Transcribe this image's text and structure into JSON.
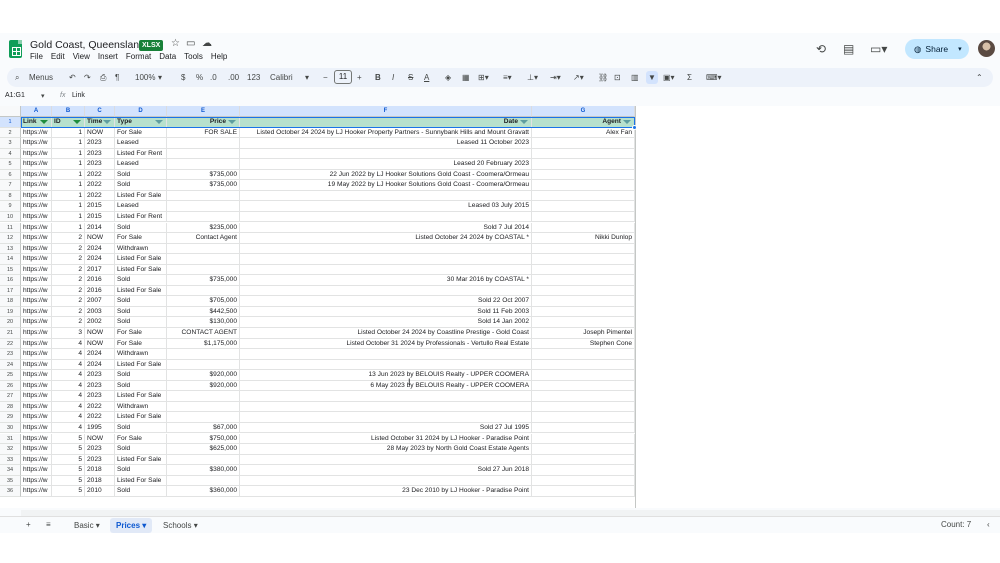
{
  "window": {
    "doc_title": "Gold Coast, Queensland",
    "file_badge": "XLSX",
    "menus": [
      "File",
      "Edit",
      "View",
      "Insert",
      "Format",
      "Data",
      "Tools",
      "Help"
    ],
    "share_label": "Share"
  },
  "toolbar": {
    "menus_label": "Menus",
    "zoom": "100%",
    "currency": "$",
    "percent": "%",
    "decimal_decrease": ".0",
    "decimal_increase": ".00",
    "number_format": "123",
    "font": "Calibri",
    "font_size": "11",
    "bold": "B",
    "italic": "I",
    "strike": "S",
    "text_color": "A",
    "functions": "Σ"
  },
  "formula_bar": {
    "name_box": "A1:G1",
    "fx": "fx",
    "content": "Link"
  },
  "grid": {
    "column_letters": [
      "A",
      "B",
      "C",
      "D",
      "E",
      "F",
      "G"
    ],
    "headers": [
      "Link",
      "ID",
      "Time",
      "Type",
      "Price",
      "Date",
      "Agent"
    ],
    "rows": [
      [
        "https://w",
        "1",
        "NOW",
        "For Sale",
        "FOR SALE",
        "Listed October 24 2024 by LJ Hooker Property Partners - Sunnybank Hills and Mount Gravatt",
        "Alex Fan"
      ],
      [
        "https://w",
        "1",
        "2023",
        "Leased",
        "",
        "Leased 11 October 2023",
        ""
      ],
      [
        "https://w",
        "1",
        "2023",
        "Listed For Rent",
        "",
        "",
        ""
      ],
      [
        "https://w",
        "1",
        "2023",
        "Leased",
        "",
        "Leased 20 February 2023",
        ""
      ],
      [
        "https://w",
        "1",
        "2022",
        "Sold",
        "$735,000",
        "22 Jun 2022 by LJ Hooker Solutions Gold Coast - Coomera/Ormeau",
        ""
      ],
      [
        "https://w",
        "1",
        "2022",
        "Sold",
        "$735,000",
        "19 May 2022 by LJ Hooker Solutions Gold Coast - Coomera/Ormeau",
        ""
      ],
      [
        "https://w",
        "1",
        "2022",
        "Listed For Sale",
        "",
        "",
        ""
      ],
      [
        "https://w",
        "1",
        "2015",
        "Leased",
        "",
        "Leased 03 July 2015",
        ""
      ],
      [
        "https://w",
        "1",
        "2015",
        "Listed For Rent",
        "",
        "",
        ""
      ],
      [
        "https://w",
        "1",
        "2014",
        "Sold",
        "$235,000",
        "Sold 7 Jul 2014",
        ""
      ],
      [
        "https://w",
        "2",
        "NOW",
        "For Sale",
        "Contact Agent",
        "Listed October 24 2024 by COASTAL *",
        "Nikki Dunlop"
      ],
      [
        "https://w",
        "2",
        "2024",
        "Withdrawn",
        "",
        "",
        ""
      ],
      [
        "https://w",
        "2",
        "2024",
        "Listed For Sale",
        "",
        "",
        ""
      ],
      [
        "https://w",
        "2",
        "2017",
        "Listed For Sale",
        "",
        "",
        ""
      ],
      [
        "https://w",
        "2",
        "2016",
        "Sold",
        "$735,000",
        "30 Mar 2016 by COASTAL *",
        ""
      ],
      [
        "https://w",
        "2",
        "2016",
        "Listed For Sale",
        "",
        "",
        ""
      ],
      [
        "https://w",
        "2",
        "2007",
        "Sold",
        "$705,000",
        "Sold 22 Oct 2007",
        ""
      ],
      [
        "https://w",
        "2",
        "2003",
        "Sold",
        "$442,500",
        "Sold 11 Feb 2003",
        ""
      ],
      [
        "https://w",
        "2",
        "2002",
        "Sold",
        "$130,000",
        "Sold 14 Jan 2002",
        ""
      ],
      [
        "https://w",
        "3",
        "NOW",
        "For Sale",
        "CONTACT AGENT",
        "Listed October 24 2024 by Coastline Prestige - Gold Coast",
        "Joseph Pimentel"
      ],
      [
        "https://w",
        "4",
        "NOW",
        "For Sale",
        "$1,175,000",
        "Listed October 31 2024 by Professionals - Vertullo Real Estate",
        "Stephen Cone"
      ],
      [
        "https://w",
        "4",
        "2024",
        "Withdrawn",
        "",
        "",
        ""
      ],
      [
        "https://w",
        "4",
        "2024",
        "Listed For Sale",
        "",
        "",
        ""
      ],
      [
        "https://w",
        "4",
        "2023",
        "Sold",
        "$920,000",
        "13 Jun 2023 by BELOUIS Realty - UPPER COOMERA",
        ""
      ],
      [
        "https://w",
        "4",
        "2023",
        "Sold",
        "$920,000",
        "6 May 2023 by BELOUIS Realty - UPPER COOMERA",
        ""
      ],
      [
        "https://w",
        "4",
        "2023",
        "Listed For Sale",
        "",
        "",
        ""
      ],
      [
        "https://w",
        "4",
        "2022",
        "Withdrawn",
        "",
        "",
        ""
      ],
      [
        "https://w",
        "4",
        "2022",
        "Listed For Sale",
        "",
        "",
        ""
      ],
      [
        "https://w",
        "4",
        "1995",
        "Sold",
        "$67,000",
        "Sold 27 Jul 1995",
        ""
      ],
      [
        "https://w",
        "5",
        "NOW",
        "For Sale",
        "$750,000",
        "Listed October 31 2024 by LJ Hooker - Paradise Point",
        ""
      ],
      [
        "https://w",
        "5",
        "2023",
        "Sold",
        "$625,000",
        "28 May 2023 by North Gold Coast Estate Agents",
        ""
      ],
      [
        "https://w",
        "5",
        "2023",
        "Listed For Sale",
        "",
        "",
        ""
      ],
      [
        "https://w",
        "5",
        "2018",
        "Sold",
        "$380,000",
        "Sold 27 Jun 2018",
        ""
      ],
      [
        "https://w",
        "5",
        "2018",
        "Listed For Sale",
        "",
        "",
        ""
      ],
      [
        "https://w",
        "5",
        "2010",
        "Sold",
        "$360,000",
        "23 Dec 2010 by LJ Hooker - Paradise Point",
        ""
      ]
    ]
  },
  "sheets": {
    "tabs": [
      "Basic",
      "Prices",
      "Schools"
    ],
    "active": "Prices",
    "status": "Count: 7"
  },
  "colors": {
    "header_fill": "#b7e1cd",
    "accent": "#0b57d0",
    "share_bg": "#c2e7ff"
  }
}
